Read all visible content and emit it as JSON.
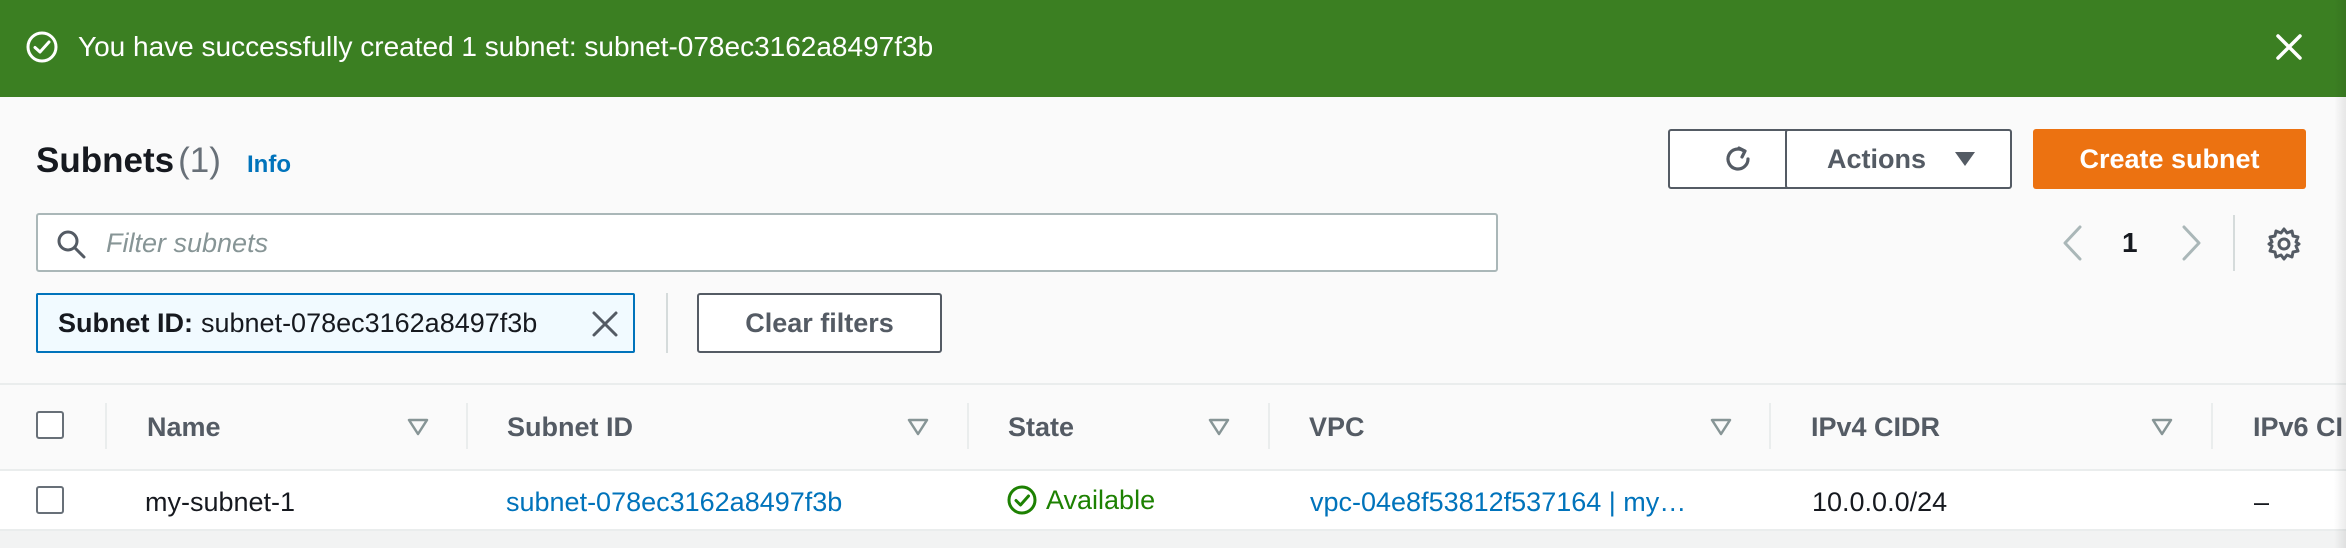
{
  "banner": {
    "message": "You have successfully created 1 subnet: subnet-078ec3162a8497f3b",
    "icon": "check-circle-icon",
    "close_icon": "close-icon",
    "color": "#3b7f22"
  },
  "header": {
    "title": "Subnets",
    "count": "(1)",
    "info_label": "Info",
    "actions_label": "Actions",
    "create_label": "Create subnet",
    "create_color": "#ec7211"
  },
  "search": {
    "placeholder": "Filter subnets",
    "value": ""
  },
  "pagination": {
    "current_page": "1"
  },
  "filter_token": {
    "key": "Subnet ID:",
    "value": "subnet-078ec3162a8497f3b"
  },
  "clear_filters_label": "Clear filters",
  "table": {
    "columns": [
      "Name",
      "Subnet ID",
      "State",
      "VPC",
      "IPv4 CIDR",
      "IPv6 CI"
    ],
    "rows": [
      {
        "name": "my-subnet-1",
        "subnet_id": "subnet-078ec3162a8497f3b",
        "state": "Available",
        "vpc": "vpc-04e8f53812f537164 | my…",
        "ipv4_cidr": "10.0.0.0/24",
        "ipv6_cidr": "–"
      }
    ]
  },
  "colors": {
    "link": "#0073bb",
    "available": "#1d8102"
  }
}
